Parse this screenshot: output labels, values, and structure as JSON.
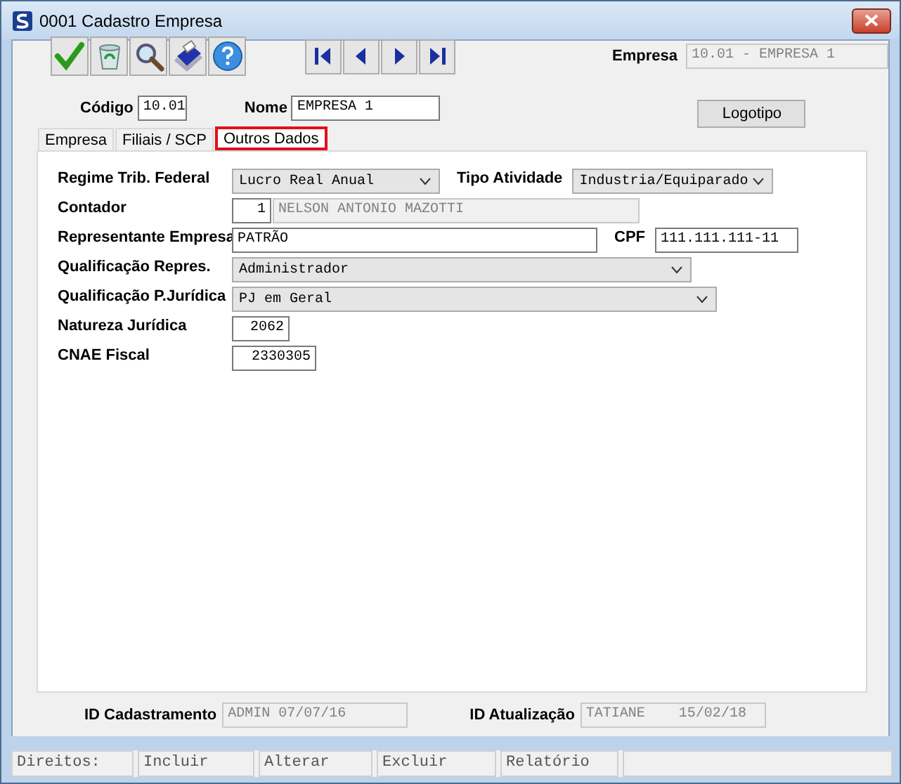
{
  "window": {
    "title": "0001 Cadastro Empresa"
  },
  "toolbar": {
    "actions": [
      {
        "kind": "confirm"
      },
      {
        "kind": "trash"
      },
      {
        "kind": "search"
      },
      {
        "kind": "print"
      },
      {
        "kind": "help"
      }
    ],
    "navigation": [
      {
        "kind": "first"
      },
      {
        "kind": "previous"
      },
      {
        "kind": "next"
      },
      {
        "kind": "last"
      }
    ]
  },
  "empresa": {
    "label": "Empresa",
    "value": "10.01 - EMPRESA 1",
    "disabled": true
  },
  "codigo": {
    "label": "Código",
    "value": "10.01"
  },
  "nome": {
    "label": "Nome",
    "value": "EMPRESA 1"
  },
  "logo_button": "Logotipo",
  "tabs": [
    {
      "label": "Empresa",
      "selected": false
    },
    {
      "label": "Filiais / SCP",
      "selected": false
    },
    {
      "label": "Outros Dados",
      "selected": true
    }
  ],
  "form": [
    {
      "label": "Regime Trib. Federal",
      "items": [
        {
          "kind": "select",
          "value": "Lucro Real Anual"
        },
        {
          "kind": "label",
          "text": "Tipo Atividade"
        },
        {
          "kind": "select",
          "value": "Industria/Equiparado"
        }
      ]
    },
    {
      "label": "Contador",
      "items": [
        {
          "kind": "text",
          "value": "1",
          "disabled": false
        },
        {
          "kind": "text",
          "value": "NELSON ANTONIO MAZOTTI",
          "disabled": true
        }
      ]
    },
    {
      "label": "Representante Empresa",
      "items": [
        {
          "kind": "text",
          "value": "PATRÃO",
          "disabled": false
        },
        {
          "kind": "label",
          "text": "CPF"
        },
        {
          "kind": "text",
          "value": "111.111.111-11",
          "disabled": false
        }
      ]
    },
    {
      "label": "Qualificação Repres.",
      "items": [
        {
          "kind": "select",
          "value": "Administrador"
        }
      ]
    },
    {
      "label": "Qualificação P.Jurídica",
      "items": [
        {
          "kind": "select",
          "value": "PJ em Geral"
        }
      ]
    },
    {
      "label": "Natureza Jurídica",
      "items": [
        {
          "kind": "text",
          "value": "2062",
          "disabled": false
        }
      ]
    },
    {
      "label": "CNAE Fiscal",
      "items": [
        {
          "kind": "text",
          "value": "2330305",
          "disabled": false
        }
      ]
    }
  ],
  "audit": [
    {
      "label": "ID Cadastramento",
      "value": "ADMIN 07/07/16",
      "disabled": true
    },
    {
      "label": "ID Atualização",
      "value": "TATIANE    15/02/18",
      "disabled": true
    }
  ],
  "status_bar": [
    "Direitos:",
    "Incluir",
    "Alterar",
    "Excluir",
    "Relatório"
  ]
}
